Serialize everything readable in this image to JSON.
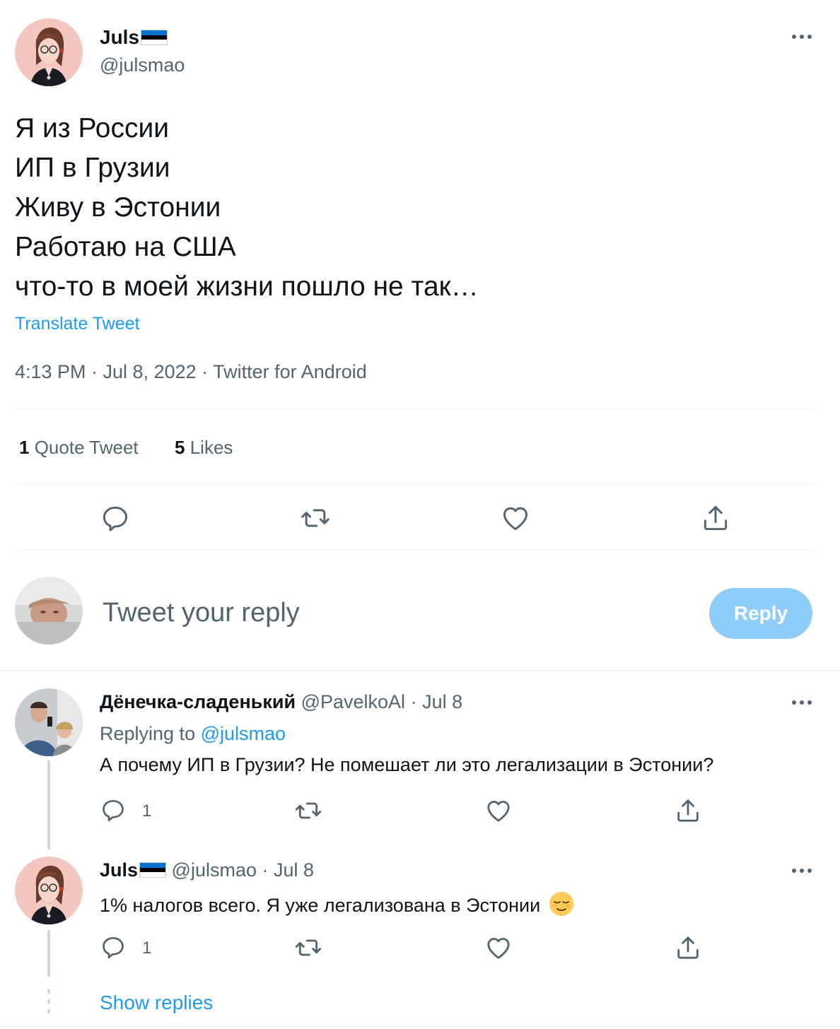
{
  "main_tweet": {
    "author_name": "Juls",
    "author_handle": "@julsmao",
    "lines": [
      "Я из России",
      "ИП в Грузии",
      "Живу в Эстонии",
      "Работаю на США",
      "что-то в моей жизни пошло не так…"
    ],
    "translate_label": "Translate Tweet",
    "meta": "4:13 PM · Jul 8, 2022 · Twitter for Android",
    "stats": {
      "quote_count": "1",
      "quote_label": "Quote Tweet",
      "likes_count": "5",
      "likes_label": "Likes"
    }
  },
  "composer": {
    "placeholder": "Tweet your reply",
    "button_label": "Reply"
  },
  "replies": [
    {
      "author_name": "Дёнечка-сладенький",
      "author_handle": "@PavelkoAl",
      "date_sep": "·",
      "date": "Jul 8",
      "replying_to_label": "Replying to",
      "replying_to_handle": "@julsmao",
      "text": "А почему ИП в Грузии? Не помешает ли это легализации в Эстонии?",
      "reply_count": "1"
    },
    {
      "author_name": "Juls",
      "author_handle": "@julsmao",
      "date_sep": "·",
      "date": "Jul 8",
      "text": "1% налогов всего. Я уже легализована в Эстонии",
      "emoji": "relieved-face",
      "reply_count": "1"
    }
  ],
  "show_replies_label": "Show replies",
  "colors": {
    "accent": "#1d9bf0",
    "reply_button_disabled": "#8ecdf8",
    "muted_text": "#536471",
    "divider": "#eff3f4"
  }
}
